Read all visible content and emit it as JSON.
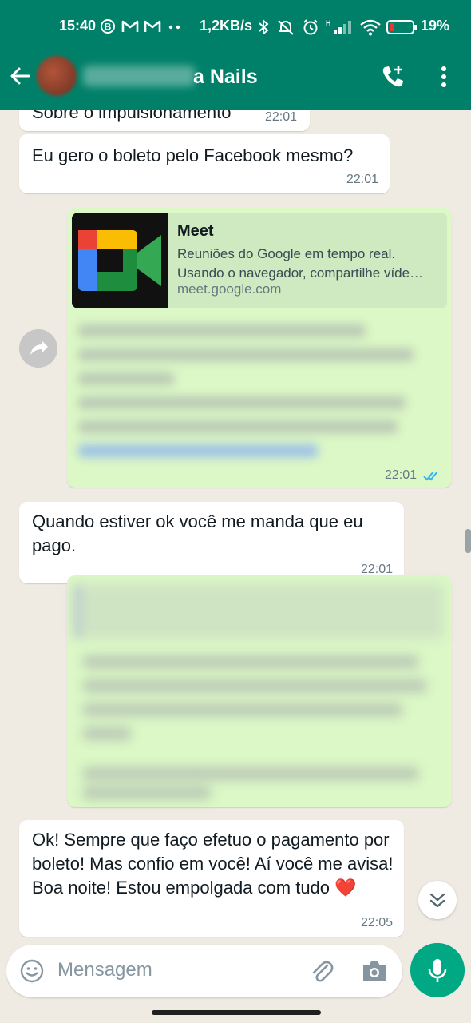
{
  "status_bar": {
    "time": "15:40",
    "speed": "1,2KB/s",
    "battery": "19%",
    "icons": [
      "b-badge-icon",
      "gmail-icon",
      "gmail-icon",
      "dots-icon",
      "bluetooth-icon",
      "bell-off-icon",
      "alarm-icon",
      "signal-icon",
      "wifi-icon",
      "battery-icon"
    ]
  },
  "header": {
    "contact_name_visible": "a Nails",
    "icons": [
      "back-arrow-icon",
      "avatar",
      "add-call-icon",
      "more-vert-icon"
    ],
    "color": "#008069"
  },
  "messages": [
    {
      "direction": "in",
      "text": "Sobre o impulsionamento",
      "time": "22:01"
    },
    {
      "direction": "in",
      "text": "Eu gero o boleto pelo Facebook mesmo?",
      "time": "22:01"
    },
    {
      "direction": "out",
      "link_preview": {
        "title": "Meet",
        "description": "Reuniões do Google em tempo real. Usando o navegador, compartilhe víde…",
        "url": "meet.google.com"
      },
      "time": "22:01",
      "read": true
    },
    {
      "direction": "in",
      "text": "Quando estiver ok você me manda que eu pago.",
      "time": "22:01"
    },
    {
      "direction": "out",
      "blurred": true
    },
    {
      "direction": "in",
      "text": "Ok! Sempre que faço efetuo o pagamento por boleto! Mas confio em você! Aí você me avisa! Boa noite! Estou empolgada com tudo ❤️",
      "time": "22:05"
    }
  ],
  "input": {
    "placeholder": "Mensagem"
  },
  "colors": {
    "incoming": "#ffffff",
    "outgoing": "#dcf8c6",
    "chat_bg": "#efeae2",
    "accent": "#00a884",
    "read_ticks": "#34b7f1"
  }
}
